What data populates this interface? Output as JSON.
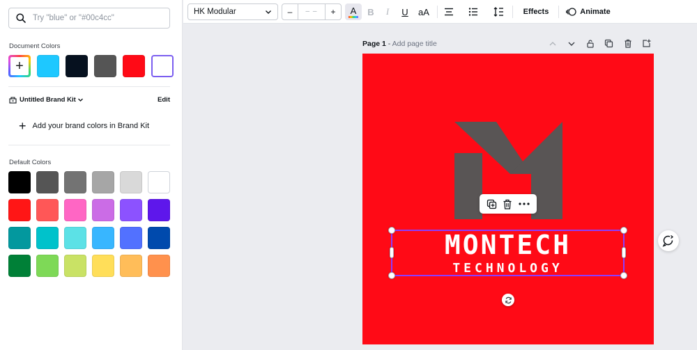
{
  "search": {
    "placeholder": "Try \"blue\" or \"#00c4cc\""
  },
  "document_colors": {
    "label": "Document Colors",
    "add_label": "+",
    "swatches": [
      "#1ec8ff",
      "#06111f",
      "#555555",
      "#ff0a16",
      "#ffffff"
    ]
  },
  "brand_kit": {
    "name": "Untitled Brand Kit",
    "edit_label": "Edit",
    "add_label": "Add your brand colors in Brand Kit"
  },
  "default_colors": {
    "label": "Default Colors",
    "rows": [
      [
        "#000000",
        "#555555",
        "#737373",
        "#a6a6a6",
        "#d9d9d9",
        "#ffffff"
      ],
      [
        "#ff1616",
        "#ff5757",
        "#ff66c4",
        "#cb6ce6",
        "#8c52ff",
        "#5e17eb"
      ],
      [
        "#03989e",
        "#00c2cb",
        "#5ce1e6",
        "#38b6ff",
        "#5271ff",
        "#004aad"
      ],
      [
        "#008037",
        "#7ed957",
        "#c9e265",
        "#ffde59",
        "#ffbd59",
        "#ff914d"
      ]
    ]
  },
  "toolbar": {
    "font_name": "HK Modular",
    "size_minus": "–",
    "size_value": "– –",
    "size_plus": "+",
    "text_color_glyph": "A",
    "bold": "B",
    "italic": "I",
    "underline": "U",
    "case": "aA",
    "effects_label": "Effects",
    "animate_label": "Animate"
  },
  "page": {
    "label": "Page 1",
    "separator": " - ",
    "title_placeholder": "Add page title"
  },
  "design": {
    "background": "#ff0a16",
    "logo_color": "#595555",
    "title": "MONTECH",
    "subtitle": "TECHNOLOGY"
  },
  "colors": {
    "accent": "#8b3dff"
  }
}
